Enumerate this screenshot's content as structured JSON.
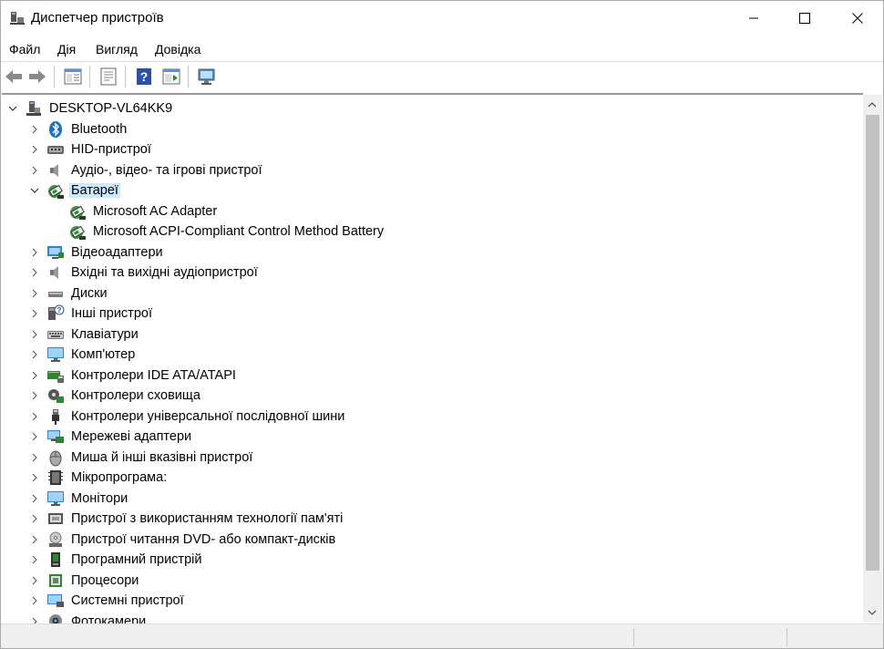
{
  "window": {
    "title": "Диспетчер пристроїв"
  },
  "menu": [
    "Файл",
    "Дія",
    "Вигляд",
    "Довідка"
  ],
  "toolbar": {
    "icons": [
      "back-arrow-icon",
      "forward-arrow-icon",
      "properties-icon",
      "update-driver-icon",
      "help-icon",
      "action-pane-icon",
      "scan-hardware-icon"
    ]
  },
  "tree": {
    "root": "DESKTOP-VL64KK9",
    "items": [
      {
        "label": "Bluetooth",
        "icon": "bluetooth-icon",
        "expanded": false
      },
      {
        "label": "HID-пристрої",
        "icon": "hid-icon",
        "expanded": false
      },
      {
        "label": "Аудіо-, відео- та ігрові пристрої",
        "icon": "speaker-icon",
        "expanded": false
      },
      {
        "label": "Батареї",
        "icon": "battery-icon",
        "expanded": true,
        "selected": true
      },
      {
        "label": "Microsoft AC Adapter",
        "icon": "battery-icon",
        "child": true
      },
      {
        "label": "Microsoft ACPI-Compliant Control Method Battery",
        "icon": "battery-icon",
        "child": true
      },
      {
        "label": "Відеоадаптери",
        "icon": "display-adapter-icon",
        "expanded": false
      },
      {
        "label": "Вхідні та вихідні аудіопристрої",
        "icon": "speaker-icon",
        "expanded": false
      },
      {
        "label": "Диски",
        "icon": "disk-drive-icon",
        "expanded": false
      },
      {
        "label": "Інші пристрої",
        "icon": "unknown-device-icon",
        "expanded": false
      },
      {
        "label": "Клавіатури",
        "icon": "keyboard-icon",
        "expanded": false
      },
      {
        "label": "Комп'ютер",
        "icon": "computer-icon",
        "expanded": false
      },
      {
        "label": "Контролери IDE ATA/ATAPI",
        "icon": "ide-controller-icon",
        "expanded": false
      },
      {
        "label": "Контролери сховища",
        "icon": "storage-controller-icon",
        "expanded": false
      },
      {
        "label": "Контролери універсальної послідовної шини",
        "icon": "usb-icon",
        "expanded": false
      },
      {
        "label": "Мережеві адаптери",
        "icon": "network-adapter-icon",
        "expanded": false
      },
      {
        "label": "Миша й інші вказівні пристрої",
        "icon": "mouse-icon",
        "expanded": false
      },
      {
        "label": "Мікропрограма:",
        "icon": "firmware-icon",
        "expanded": false
      },
      {
        "label": "Монітори",
        "icon": "monitor-icon",
        "expanded": false
      },
      {
        "label": "Пристрої з використанням технології пам'яті",
        "icon": "memory-device-icon",
        "expanded": false
      },
      {
        "label": "Пристрої читання DVD- або компакт-дисків",
        "icon": "dvd-drive-icon",
        "expanded": false
      },
      {
        "label": "Програмний пристрій",
        "icon": "software-device-icon",
        "expanded": false
      },
      {
        "label": "Процесори",
        "icon": "processor-icon",
        "expanded": false
      },
      {
        "label": "Системні пристрої",
        "icon": "system-device-icon",
        "expanded": false
      },
      {
        "label": "Фотокамери",
        "icon": "camera-icon",
        "expanded": false
      }
    ]
  }
}
